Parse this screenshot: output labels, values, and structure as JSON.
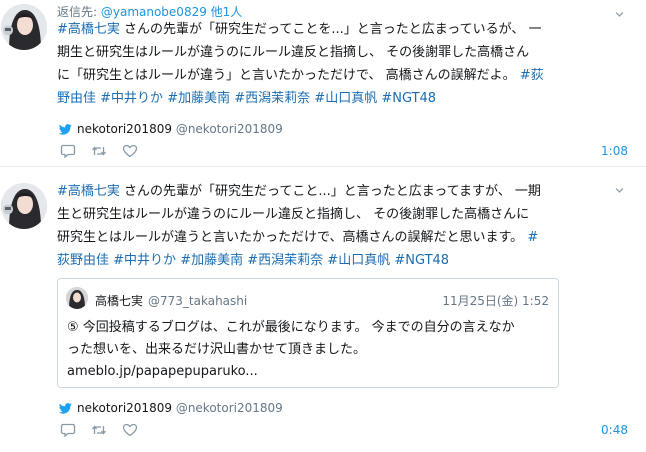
{
  "tweets": [
    {
      "reply_prefix": "返信先: ",
      "reply_handle": "@yamanobe0829",
      "reply_others": "他1人",
      "lines": [
        [
          {
            "text": "#高橋七実",
            "tag": true
          },
          {
            "text": " さんの先輩が「研究生だってことを...」と言ったと広まっているが、 一",
            "tag": false
          }
        ],
        [
          {
            "text": "期生と研究生はルールが違うのにルール違反と指摘し、 その後謝罪した高橋さん",
            "tag": false
          }
        ],
        [
          {
            "text": "に「研究生とはルールが違う」と言いたかっただけで、 高橋さんの誤解だよ。 ",
            "tag": false
          },
          {
            "text": "#荻",
            "tag": true
          }
        ],
        [
          {
            "text": "野由佳",
            "tag": true
          },
          {
            "text": " ",
            "tag": false
          },
          {
            "text": "#中井りか",
            "tag": true
          },
          {
            "text": " ",
            "tag": false
          },
          {
            "text": "#加藤美南",
            "tag": true
          },
          {
            "text": " ",
            "tag": false
          },
          {
            "text": "#西潟茉莉奈",
            "tag": true
          },
          {
            "text": " ",
            "tag": false
          },
          {
            "text": "#山口真帆",
            "tag": true
          },
          {
            "text": " ",
            "tag": false
          },
          {
            "text": "#NGT48",
            "tag": true
          }
        ]
      ],
      "via_name": "nekotori201809",
      "via_handle": "@nekotori201809",
      "time": "1:08"
    },
    {
      "lines": [
        [
          {
            "text": "#高橋七実",
            "tag": true
          },
          {
            "text": " さんの先輩が「研究生だってこと...」と言ったと広まってますが、 一期",
            "tag": false
          }
        ],
        [
          {
            "text": "生と研究生はルールが違うのにルール違反と指摘し、 その後謝罪した高橋さんに",
            "tag": false
          }
        ],
        [
          {
            "text": "研究生とはルールが違うと言いたかっただけで、高橋さんの誤解だと思います。 ",
            "tag": false
          },
          {
            "text": "#",
            "tag": true
          }
        ],
        [
          {
            "text": "荻野由佳",
            "tag": true
          },
          {
            "text": " ",
            "tag": false
          },
          {
            "text": "#中井りか",
            "tag": true
          },
          {
            "text": " ",
            "tag": false
          },
          {
            "text": "#加藤美南",
            "tag": true
          },
          {
            "text": " ",
            "tag": false
          },
          {
            "text": "#西潟茉莉奈",
            "tag": true
          },
          {
            "text": " ",
            "tag": false
          },
          {
            "text": "#山口真帆",
            "tag": true
          },
          {
            "text": " ",
            "tag": false
          },
          {
            "text": "#NGT48",
            "tag": true
          }
        ]
      ],
      "quote": {
        "name": "高橋七実",
        "handle": "@773_takahashi",
        "date": "11月25日(金) 1:52",
        "line1": "⑤ 今回投稿するブログは、これが最後になります。 今までの自分の言えなか",
        "line2": "った想いを、出来るだけ沢山書かせて頂きました。",
        "link": "ameblo.jp/papapepuparuko..."
      },
      "via_name": "nekotori201809",
      "via_handle": "@nekotori201809",
      "time": "0:48"
    }
  ],
  "colors": {
    "accent": "#1b95e0",
    "hashtag": "#1b6cb0",
    "muted": "#657786",
    "icon": "#8899a6",
    "bird": "#1da1f2",
    "border": "#e6ecf0"
  },
  "icons": {
    "caret": "chevron-down-icon",
    "bird": "twitter-bird-icon",
    "reply": "reply-icon",
    "retweet": "retweet-icon",
    "like": "heart-icon"
  }
}
